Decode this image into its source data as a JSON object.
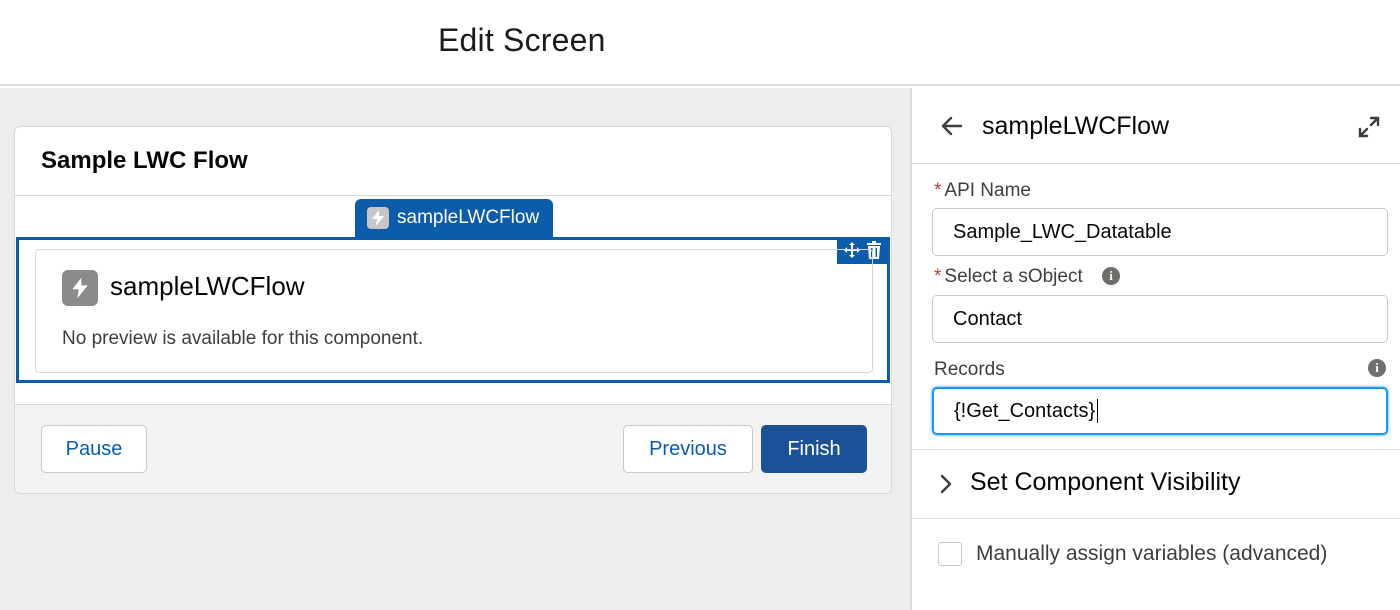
{
  "header": {
    "title": "Edit Screen"
  },
  "canvas": {
    "flow_title": "Sample LWC Flow",
    "component_tab_label": "sampleLWCFlow",
    "component": {
      "name": "sampleLWCFlow",
      "note": "No preview is available for this component."
    },
    "footer": {
      "pause_label": "Pause",
      "previous_label": "Previous",
      "finish_label": "Finish"
    }
  },
  "panel": {
    "title": "sampleLWCFlow",
    "fields": [
      {
        "label": "API Name",
        "required": true,
        "value": "Sample_LWC_Datatable"
      },
      {
        "label": "Select a sObject",
        "required": true,
        "value": "Contact"
      },
      {
        "label": "Records",
        "required": false,
        "value": "{!Get_Contacts}"
      }
    ],
    "visibility_section": "Set Component Visibility",
    "manual_assign_label": "Manually assign variables (advanced)",
    "manual_assign_checked": false
  },
  "colors": {
    "brand": "#1b5297",
    "selection": "#0b5cab",
    "focus": "#1b96ff",
    "required": "#c23934"
  }
}
